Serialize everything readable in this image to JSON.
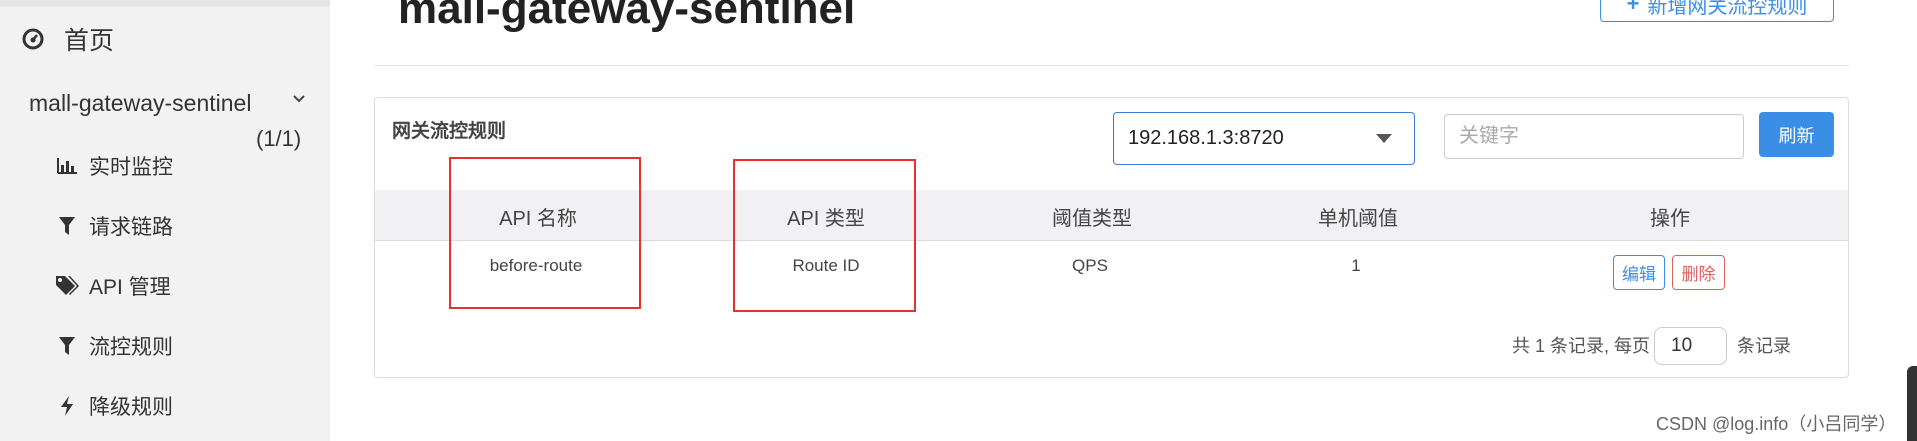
{
  "sidebar": {
    "home_label": "首页",
    "app_name": "mall-gateway-sentinel",
    "app_count": "(1/1)",
    "items": [
      {
        "label": "实时监控",
        "icon": "bar-chart-icon"
      },
      {
        "label": "请求链路",
        "icon": "filter-icon"
      },
      {
        "label": "API 管理",
        "icon": "tags-icon"
      },
      {
        "label": "流控规则",
        "icon": "filter-icon"
      },
      {
        "label": "降级规则",
        "icon": "flash-icon"
      }
    ]
  },
  "header": {
    "title": "mall-gateway-sentinel",
    "add_button_label": "新增网关流控规则"
  },
  "panel": {
    "title": "网关流控规则",
    "machine_select": "192.168.1.3:8720",
    "keyword_placeholder": "关键字",
    "refresh_label": "刷新",
    "columns": [
      "API 名称",
      "API 类型",
      "阈值类型",
      "单机阈值",
      "操作"
    ],
    "rows": [
      {
        "api_name": "before-route",
        "api_type": "Route ID",
        "threshold_type": "QPS",
        "threshold": "1",
        "edit": "编辑",
        "delete": "删除"
      }
    ],
    "pager": {
      "prefix": "共 1 条记录, 每页",
      "page_size": "10",
      "suffix": "条记录"
    }
  },
  "watermark": "CSDN @log.info（小吕同学）",
  "colors": {
    "accent": "#3a8ee6",
    "danger": "#e06060",
    "highlight_box": "#e8312f"
  }
}
